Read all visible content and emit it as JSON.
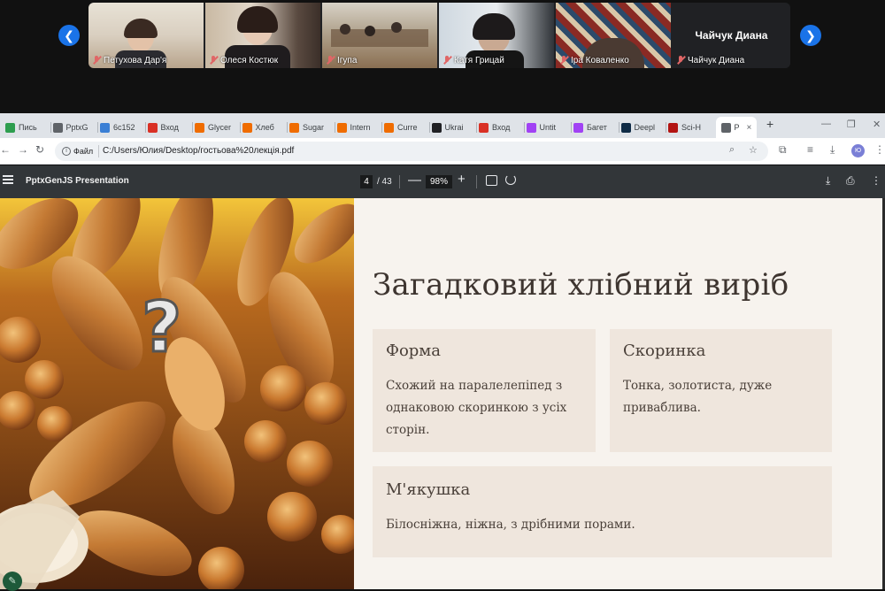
{
  "call": {
    "participants": [
      {
        "name": "Петухова Дар'я"
      },
      {
        "name": "Олеся Костюк"
      },
      {
        "name": "Ігупа"
      },
      {
        "name": "Катя Грицай"
      },
      {
        "name": "Іра Коваленко"
      },
      {
        "name": "Чайчук Диана"
      }
    ],
    "featured_name": "Чайчук Диана",
    "prev_arrow": "❮",
    "next_arrow": "❯"
  },
  "browser": {
    "tabs": [
      {
        "label": "Пись",
        "color": "#2e9e4f"
      },
      {
        "label": "PptxG",
        "color": "#5f6368"
      },
      {
        "label": "6с152",
        "color": "#3a7fd5"
      },
      {
        "label": "Вход",
        "color": "#d93025"
      },
      {
        "label": "Glycer",
        "color": "#ef6c00"
      },
      {
        "label": "Хлеб",
        "color": "#ef6c00"
      },
      {
        "label": "Sugar",
        "color": "#ef6c00"
      },
      {
        "label": "Intern",
        "color": "#ef6c00"
      },
      {
        "label": "Curre",
        "color": "#ef6c00"
      },
      {
        "label": "Ukrai",
        "color": "#202124"
      },
      {
        "label": "Вход",
        "color": "#d93025"
      },
      {
        "label": "Untit",
        "color": "#a142f4"
      },
      {
        "label": "Багет",
        "color": "#a142f4"
      },
      {
        "label": "Deepl",
        "color": "#0f2b46"
      },
      {
        "label": "Sci-H",
        "color": "#b31412"
      },
      {
        "label": "P",
        "color": "#5f6368"
      }
    ],
    "active_close": "×",
    "new_tab": "+",
    "window_controls": [
      "—",
      "❐",
      "✕"
    ],
    "site_label": "Файл",
    "url": "C:/Users/Юлия/Desktop/гостьова%20лекція.pdf",
    "profile_initial": "Ю"
  },
  "pdf": {
    "title": "PptxGenJS Presentation",
    "current_page": "4",
    "page_total": "/ 43",
    "zoom": "98%",
    "zoom_out": "—",
    "zoom_in": "+"
  },
  "slide": {
    "title": "Загадковий хлібний виріб",
    "image_overlay": "?",
    "cards": {
      "forma": {
        "heading": "Форма",
        "text": "Схожий на паралелепіпед з однаковою скоринкою з усіх сторін."
      },
      "skorynka": {
        "heading": "Скоринка",
        "text": "Тонка, золотиста, дуже приваблива."
      },
      "miakushka": {
        "heading": "М'якушка",
        "text": "Білосніжна, ніжна, з дрібними порами."
      }
    }
  }
}
